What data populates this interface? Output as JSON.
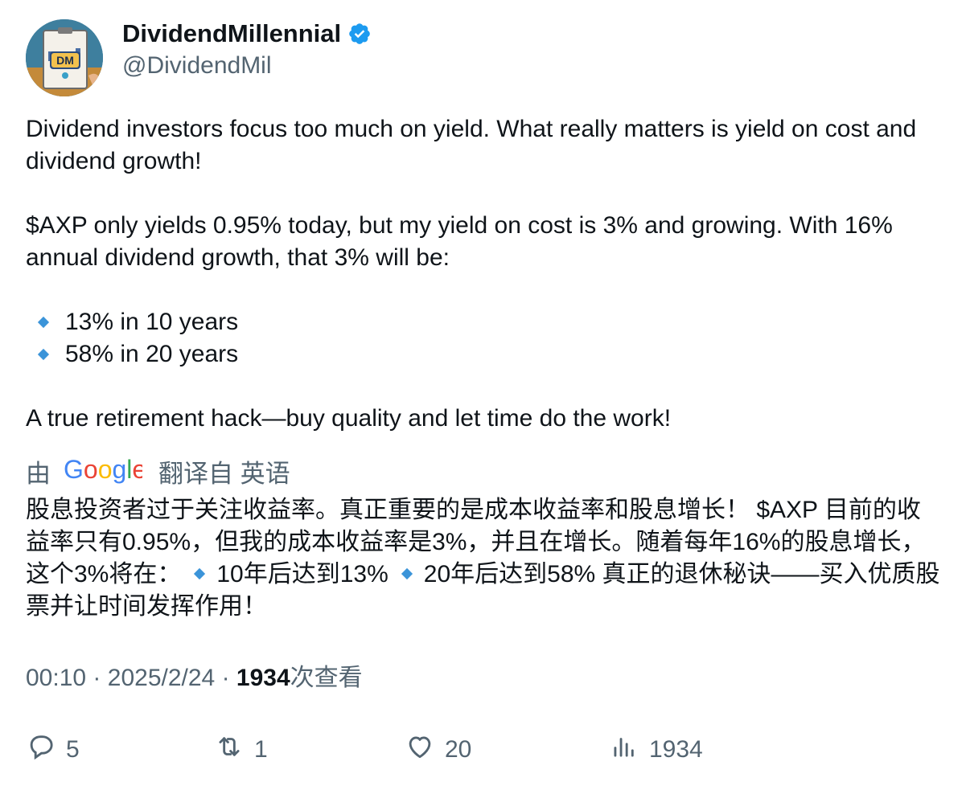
{
  "author": {
    "display_name": "DividendMillennial",
    "handle": "@DividendMil",
    "avatar_text": "DM"
  },
  "tweet": {
    "paragraph_1": "Dividend investors focus too much on yield.  What really matters is yield on cost and dividend growth!",
    "paragraph_2": "$AXP only yields 0.95% today, but my yield on cost is 3% and growing. With 16% annual dividend growth, that 3% will be:",
    "bullets": [
      "13% in 10 years",
      "58% in 20 years"
    ],
    "paragraph_3": "A true retirement hack—buy quality and let time do the work!"
  },
  "translation": {
    "prefix": "由",
    "provider_logo": "Google",
    "suffix": "翻译自 英语",
    "text_part_1": "股息投资者过于关注收益率。真正重要的是成本收益率和股息增长！ $AXP 目前的收益率只有0.95%，但我的成本收益率是3%，并且在增长。随着每年16%的股息增长，这个3%将在：",
    "text_part_2": "10年后达到13%",
    "text_part_3": "20年后达到58% 真正的退休秘诀——买入优质股票并让时间发挥作用！"
  },
  "meta": {
    "time": "00:10",
    "separator": "·",
    "date": "2025/2/24",
    "views_count": "1934",
    "views_label": "次查看"
  },
  "actions": {
    "replies": "5",
    "retweets": "1",
    "likes": "20",
    "views": "1934"
  },
  "colors": {
    "verified": "#1d9bf0",
    "secondary_text": "#536471",
    "bullet_diamond": "#3b94d9"
  },
  "icons": [
    "verified-badge-icon",
    "reply-icon",
    "retweet-icon",
    "like-icon",
    "analytics-icon",
    "small-blue-diamond-icon",
    "google-logo"
  ]
}
